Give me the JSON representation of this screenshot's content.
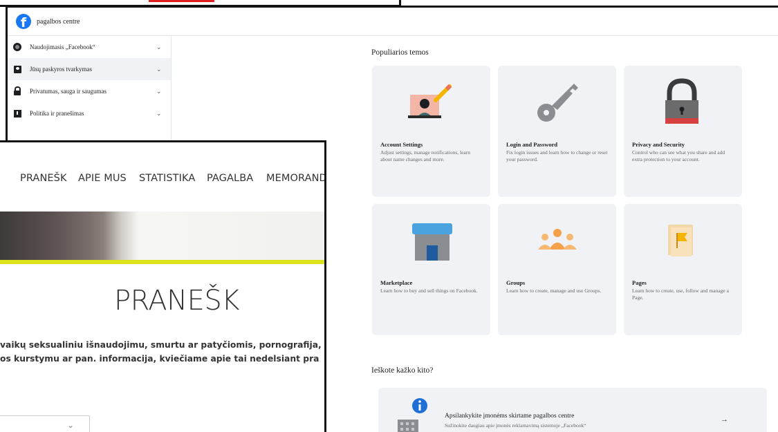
{
  "fb": {
    "brand": "pagalbos centre",
    "sidebar": {
      "items": [
        {
          "label": "Naudojimasis „Facebook“",
          "icon": "circle-icon"
        },
        {
          "label": "Jūsų paskyros tvarkymas",
          "icon": "account-icon"
        },
        {
          "label": "Privatumas, sauga ir saugumas",
          "icon": "lock-icon"
        },
        {
          "label": "Politika ir pranešimas",
          "icon": "flag-icon"
        }
      ]
    },
    "popular_title": "Populiarios temos",
    "cards": [
      {
        "title": "Account Settings",
        "desc": "Adjust settings, manage notifications, learn about name changes and more.",
        "icon": "account-settings-icon"
      },
      {
        "title": "Login and Password",
        "desc": "Fix login issues and learn how to change or reset your password.",
        "icon": "key-icon"
      },
      {
        "title": "Privacy and Security",
        "desc": "Control who can see what you share and add extra protection to your account.",
        "icon": "padlock-icon"
      },
      {
        "title": "Marketplace",
        "desc": "Learn how to buy and sell things on Facebook.",
        "icon": "store-icon"
      },
      {
        "title": "Groups",
        "desc": "Learn how to create, manage and use Groups.",
        "icon": "people-icon"
      },
      {
        "title": "Pages",
        "desc": "Learn how to create, use, follow and manage a Page.",
        "icon": "flag-page-icon"
      }
    ],
    "search_title": "Ieškote kažko kito?",
    "business": {
      "title": "Apsilankykite įmonėms skirtame pagalbos centre",
      "desc": "Sužinokite daugiau apie įmonės reklamavimą sistemoje „Facebook“",
      "arrow": "→"
    },
    "colors": {
      "brand": "#1877f2",
      "card_bg": "#f0f2f5"
    }
  },
  "site": {
    "nav": [
      "PRANEŠK",
      "APIE MUS",
      "STATISTIKA",
      "PAGALBA",
      "MEMORANDUMAS"
    ],
    "heading": "PRANEŠK",
    "body_lines": [
      "vaikų seksualiniu išnaudojimu, smurtu ar patyčiomis, pornografija,",
      "os kurstymu ar pan. informacija, kviečiame apie tai nedelsiant pra"
    ],
    "select_chevron": "⌄",
    "colors": {
      "accent_line": "#dbe11a"
    }
  }
}
